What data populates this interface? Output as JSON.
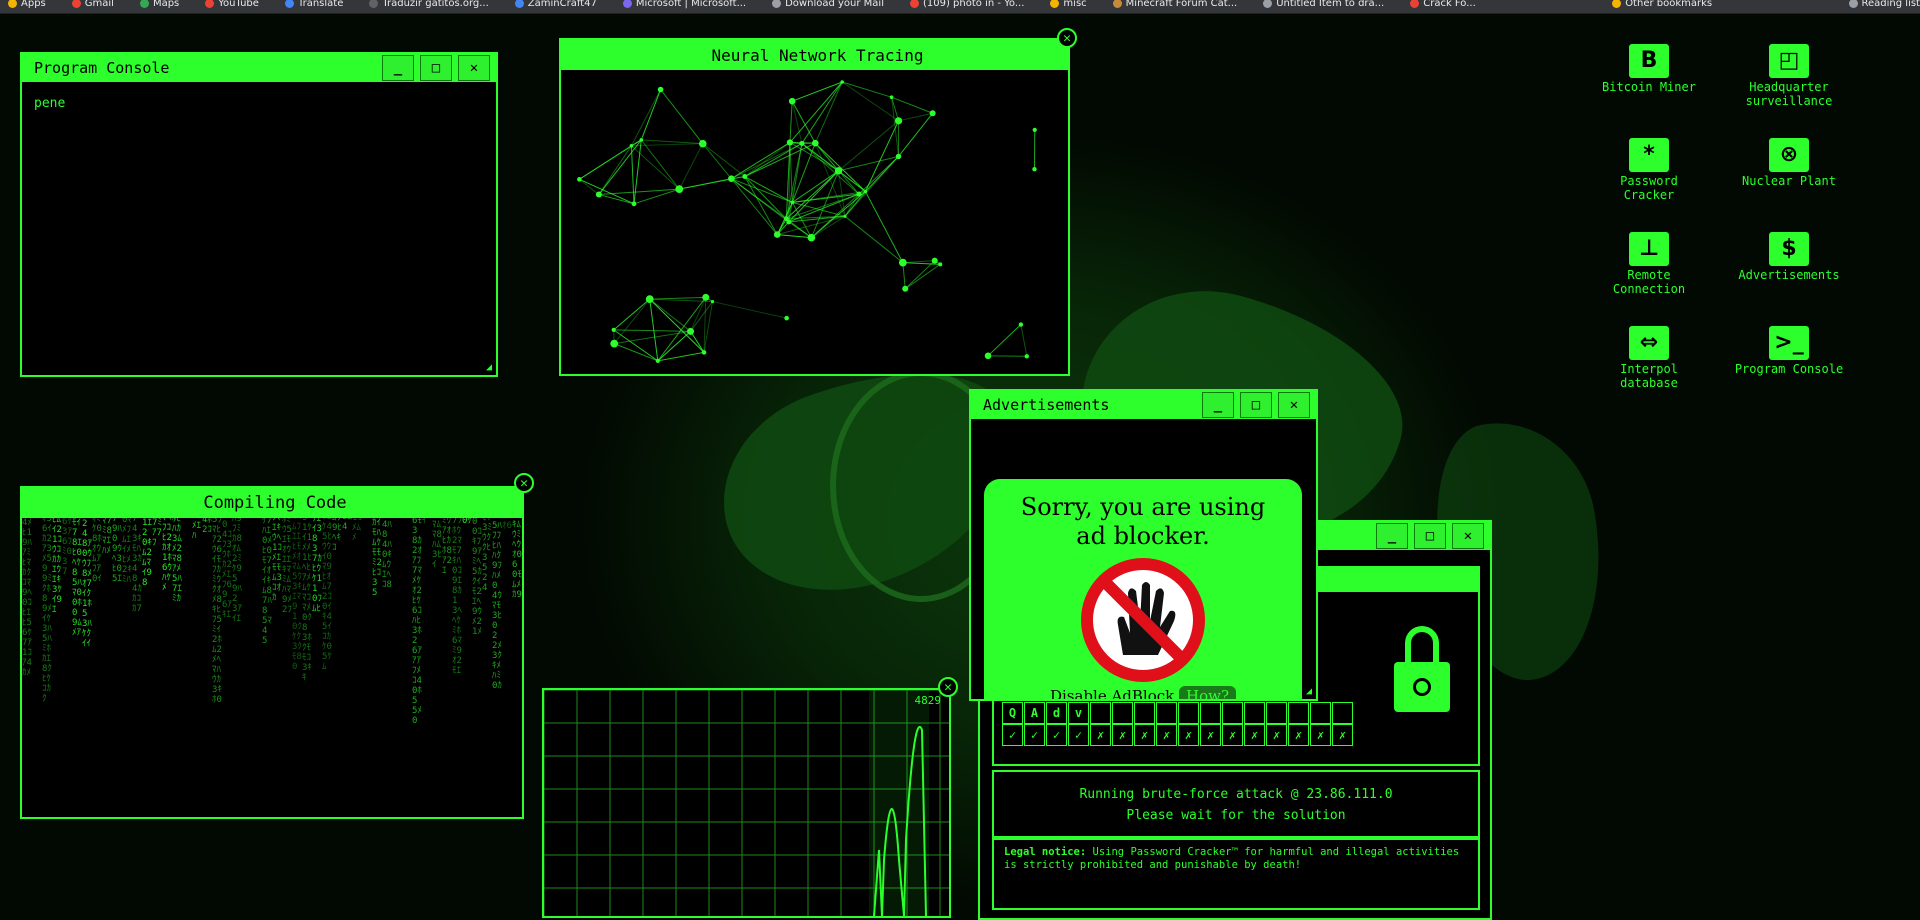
{
  "bookmarks": [
    "Apps",
    "Gmail",
    "Maps",
    "YouTube",
    "Translate",
    "Traduzir gatitos.org...",
    "ZaminCraft47",
    "Microsoft | Microsoft...",
    "Download your Mail",
    "(109) photo in - Yo...",
    "misc",
    "Minecraft Forum Cat...",
    "Untitled Item to dra...",
    "Crack Fo...",
    "Other bookmarks",
    "Reading list"
  ],
  "program_console": {
    "title": "Program Console",
    "text": "pene"
  },
  "neural_network": {
    "title": "Neural Network Tracing"
  },
  "compiling_code": {
    "title": "Compiling Code"
  },
  "advertisements": {
    "title": "Advertisements",
    "message": "Sorry, you are using ad blocker.",
    "disable_label": "Disable AdBlock",
    "how_label": "How?"
  },
  "password_cracker": {
    "guess_chars": [
      "Q",
      "A",
      "d",
      "v",
      "",
      "",
      "",
      "",
      "",
      "",
      "",
      "",
      "",
      "",
      "",
      ""
    ],
    "check_marks": [
      "✓",
      "✓",
      "✓",
      "✓",
      "✗",
      "✗",
      "✗",
      "✗",
      "✗",
      "✗",
      "✗",
      "✗",
      "✗",
      "✗",
      "✗",
      "✗"
    ],
    "status_line1": "Running brute-force attack @ 23.86.111.0",
    "status_line2": "Please wait for the solution",
    "legal_label": "Legal notice:",
    "legal_text": "Using Password Cracker™ for harmful and illegal activities is strictly prohibited and punishable by death!"
  },
  "graph": {
    "peak_value": "4829",
    "peaks": [
      0.35,
      0.62,
      0.7,
      0.86,
      0.92
    ]
  },
  "desktop_icons": [
    {
      "label": "Bitcoin Miner",
      "icon": "B"
    },
    {
      "label": "Headquarter surveillance",
      "icon": "◰"
    },
    {
      "label": "Password Cracker",
      "icon": "*"
    },
    {
      "label": "Nuclear Plant",
      "icon": "⊗"
    },
    {
      "label": "Remote Connection",
      "icon": "⊥"
    },
    {
      "label": "Advertisements",
      "icon": "$"
    },
    {
      "label": "Interpol database",
      "icon": "⇔"
    },
    {
      "label": "Program Console",
      "icon": ">_"
    }
  ],
  "colors": {
    "accent": "#2cff2c",
    "background": "#020802",
    "warning_red": "#e0101a"
  }
}
